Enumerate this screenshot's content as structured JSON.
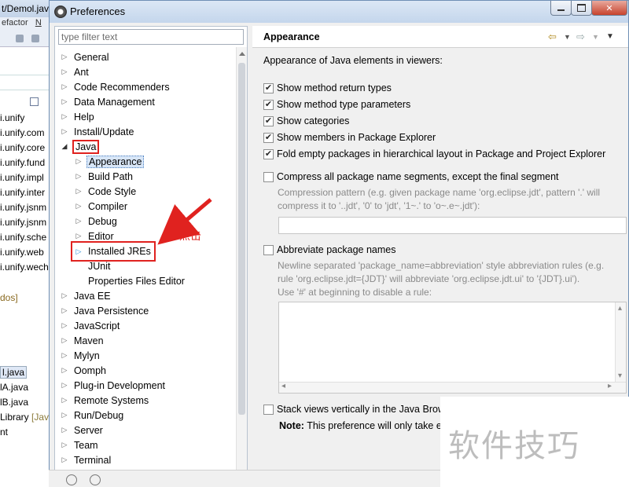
{
  "background_window": {
    "title": "t/Demol.java",
    "menu": [
      "efactor",
      "N"
    ],
    "tree_rows": [
      "i.unify",
      "i.unify.com",
      "i.unify.core",
      "i.unify.fund",
      "i.unify.impl",
      "i.unify.inter",
      "i.unify.jsnm",
      "i.unify.jsnm",
      "i.unify.sche",
      "i.unify.web",
      "i.unify.wech"
    ],
    "misc_rows": [
      "dos]",
      "l.java",
      "lA.java",
      "lB.java",
      "Library",
      "[Jav",
      "nt"
    ]
  },
  "dialog": {
    "title": "Preferences",
    "filter_placeholder": "type filter text",
    "tree": [
      {
        "label": "General",
        "level": 0,
        "expanded": false
      },
      {
        "label": "Ant",
        "level": 0,
        "expanded": false
      },
      {
        "label": "Code Recommenders",
        "level": 0,
        "expanded": false
      },
      {
        "label": "Data Management",
        "level": 0,
        "expanded": false
      },
      {
        "label": "Help",
        "level": 0,
        "expanded": false
      },
      {
        "label": "Install/Update",
        "level": 0,
        "expanded": false
      },
      {
        "label": "Java",
        "level": 0,
        "expanded": true
      },
      {
        "label": "Appearance",
        "level": 1,
        "expanded": false
      },
      {
        "label": "Build Path",
        "level": 1,
        "expanded": false
      },
      {
        "label": "Code Style",
        "level": 1,
        "expanded": false
      },
      {
        "label": "Compiler",
        "level": 1,
        "expanded": false
      },
      {
        "label": "Debug",
        "level": 1,
        "expanded": false
      },
      {
        "label": "Editor",
        "level": 1,
        "expanded": false
      },
      {
        "label": "Installed JREs",
        "level": 1,
        "expanded": false
      },
      {
        "label": "JUnit",
        "level": 1,
        "expanded": null
      },
      {
        "label": "Properties Files Editor",
        "level": 1,
        "expanded": null
      },
      {
        "label": "Java EE",
        "level": 0,
        "expanded": false
      },
      {
        "label": "Java Persistence",
        "level": 0,
        "expanded": false
      },
      {
        "label": "JavaScript",
        "level": 0,
        "expanded": false
      },
      {
        "label": "Maven",
        "level": 0,
        "expanded": false
      },
      {
        "label": "Mylyn",
        "level": 0,
        "expanded": false
      },
      {
        "label": "Oomph",
        "level": 0,
        "expanded": false
      },
      {
        "label": "Plug-in Development",
        "level": 0,
        "expanded": false
      },
      {
        "label": "Remote Systems",
        "level": 0,
        "expanded": false
      },
      {
        "label": "Run/Debug",
        "level": 0,
        "expanded": false
      },
      {
        "label": "Server",
        "level": 0,
        "expanded": false
      },
      {
        "label": "Team",
        "level": 0,
        "expanded": false
      },
      {
        "label": "Terminal",
        "level": 0,
        "expanded": false
      },
      {
        "label": "T",
        "level": 0,
        "expanded": false
      }
    ],
    "selected_item": "Appearance",
    "annotation_label": "点击",
    "page_title": "Appearance",
    "intro": "Appearance of Java elements in viewers:",
    "checkboxes": [
      {
        "label": "Show method return types",
        "checked": true
      },
      {
        "label": "Show method type parameters",
        "checked": true
      },
      {
        "label": "Show categories",
        "checked": true
      },
      {
        "label": "Show members in Package Explorer",
        "checked": true
      },
      {
        "label": "Fold empty packages in hierarchical layout in Package and Project Explorer",
        "checked": true
      }
    ],
    "compress": {
      "label": "Compress all package name segments, except the final segment",
      "checked": false,
      "help_line1": "Compression pattern (e.g. given package name 'org.eclipse.jdt', pattern '.' will",
      "help_line2": "compress it to '..jdt', '0' to 'jdt', '1~.' to 'o~.e~.jdt'):"
    },
    "abbreviate": {
      "label": "Abbreviate package names",
      "checked": false,
      "help_line1": "Newline separated 'package_name=abbreviation' style abbreviation rules (e.g.",
      "help_line2": "rule 'org.eclipse.jdt={JDT}' will abbreviate 'org.eclipse.jdt.ui' to '{JDT}.ui').",
      "help_line3": "Use '#' at beginning to disable a rule:"
    },
    "stack_views": {
      "label": "Stack views vertically in the Java Brows",
      "checked": false
    },
    "note_label": "Note:",
    "note_text": "This preference will only take e"
  },
  "watermark": "软件技巧"
}
